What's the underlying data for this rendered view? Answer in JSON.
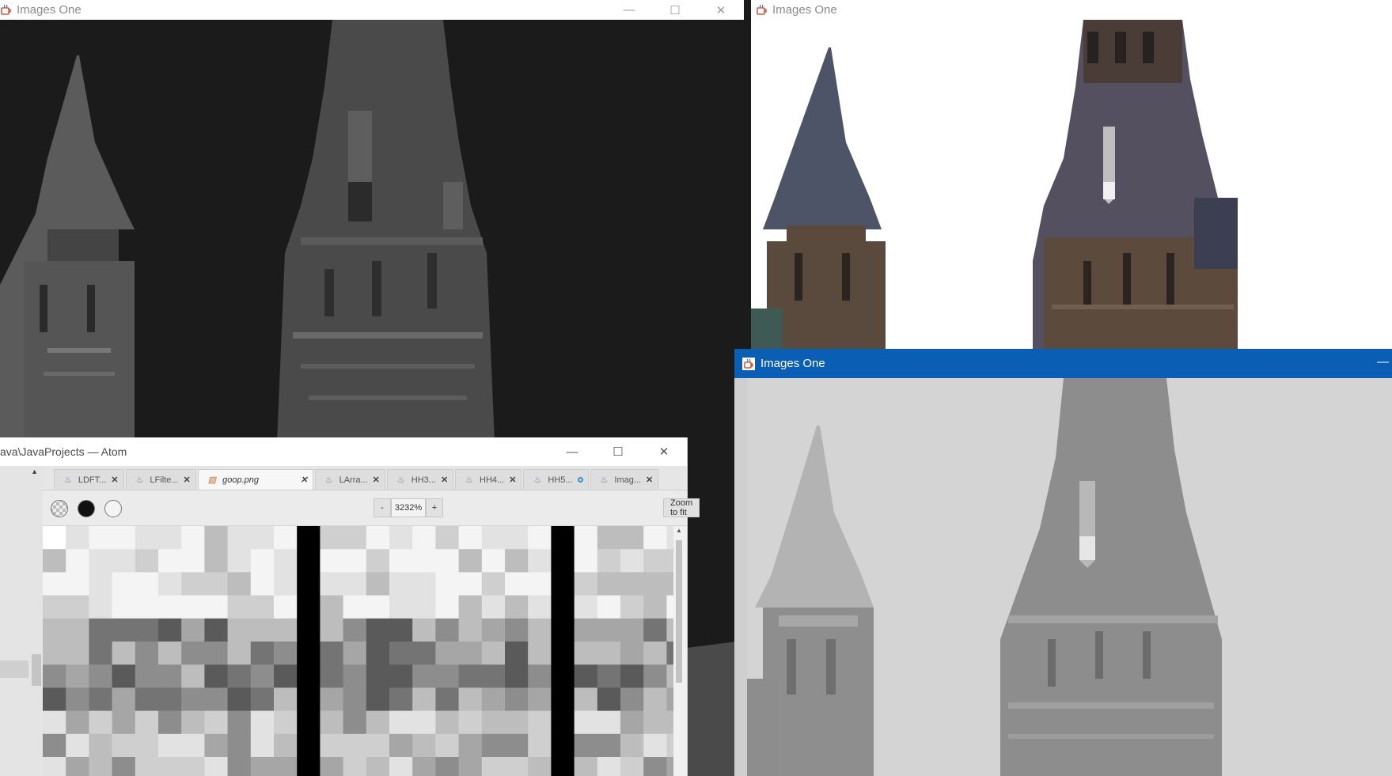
{
  "windows": {
    "left": {
      "title": "Images One"
    },
    "topRight": {
      "title": "Images One"
    },
    "bottomRight": {
      "title": "Images One"
    }
  },
  "icons": {
    "java": "java-cup-icon",
    "minimize": "minimize-icon",
    "maximize": "maximize-icon",
    "close": "close-icon",
    "imageFile": "image-file-icon",
    "scrollUp": "scroll-up-arrow-icon"
  },
  "atom": {
    "title": "ava\\JavaProjects — Atom",
    "tabs": [
      {
        "label": "LDFT...",
        "state": "close",
        "active": false
      },
      {
        "label": "LFilte...",
        "state": "close",
        "active": false
      },
      {
        "label": "goop.png",
        "state": "close",
        "active": true
      },
      {
        "label": "LArra...",
        "state": "close",
        "active": false
      },
      {
        "label": "HH3...",
        "state": "close",
        "active": false
      },
      {
        "label": "HH4...",
        "state": "close",
        "active": false
      },
      {
        "label": "HH5...",
        "state": "modified",
        "active": false
      },
      {
        "label": "Imag...",
        "state": "close",
        "active": false
      }
    ],
    "imageView": {
      "zoomOut": "-",
      "zoomLevel": "3232%",
      "zoomIn": "+",
      "zoomToFit": "Zoom to fit",
      "backgrounds": [
        "transparent-checker",
        "black",
        "white"
      ]
    }
  },
  "colors": {
    "activeTitlebar": "#0a5fb4",
    "darkImageBg": "#1b1b1b",
    "lightImageBg": "#d3d3d3"
  }
}
